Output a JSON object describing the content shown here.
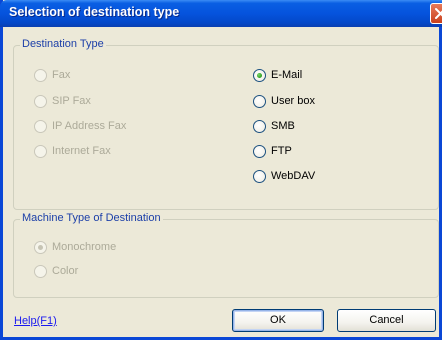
{
  "window": {
    "title": "Selection of destination type"
  },
  "destination_group": {
    "legend": "Destination Type",
    "left_options": [
      {
        "label": "Fax",
        "checked": false,
        "enabled": false
      },
      {
        "label": "SIP Fax",
        "checked": false,
        "enabled": false
      },
      {
        "label": "IP Address Fax",
        "checked": false,
        "enabled": false
      },
      {
        "label": "Internet Fax",
        "checked": false,
        "enabled": false
      }
    ],
    "right_options": [
      {
        "label": "E-Mail",
        "checked": true,
        "enabled": true
      },
      {
        "label": "User box",
        "checked": false,
        "enabled": true
      },
      {
        "label": "SMB",
        "checked": false,
        "enabled": true
      },
      {
        "label": "FTP",
        "checked": false,
        "enabled": true
      },
      {
        "label": "WebDAV",
        "checked": false,
        "enabled": true
      }
    ]
  },
  "machine_group": {
    "legend": "Machine Type of Destination",
    "options": [
      {
        "label": "Monochrome",
        "checked": true,
        "enabled": false
      },
      {
        "label": "Color",
        "checked": false,
        "enabled": false
      }
    ]
  },
  "footer": {
    "help_link": "Help(F1)",
    "ok_label": "OK",
    "cancel_label": "Cancel"
  },
  "colors": {
    "title_bar": "#0553dd",
    "window_bg": "#ece9d8",
    "legend_text": "#1c3fa8",
    "disabled_text": "#acaa99",
    "link": "#1a1af0"
  }
}
